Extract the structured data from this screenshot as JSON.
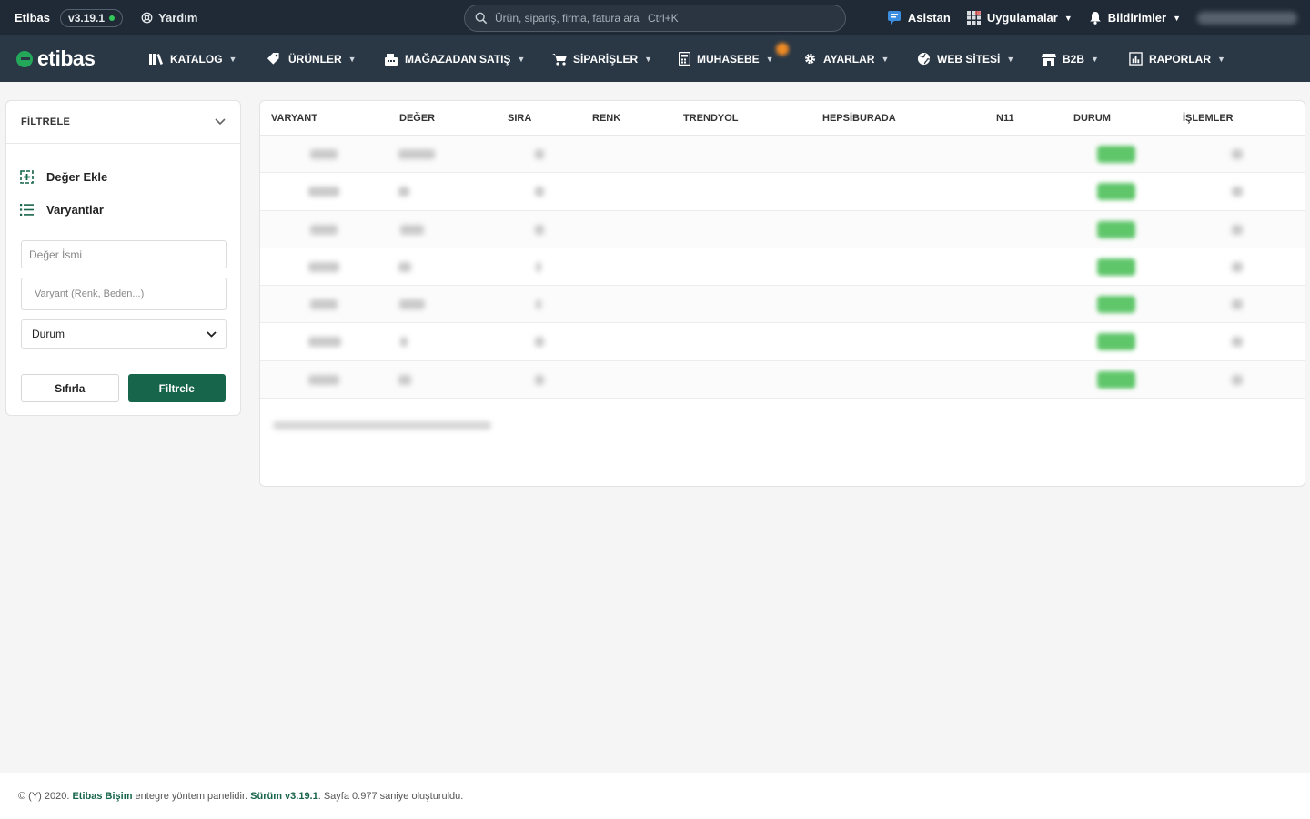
{
  "topbar": {
    "brand": "Etibas",
    "version": "v3.19.1",
    "help_label": "Yardım",
    "search_placeholder": "Ürün, sipariş, firma, fatura ara...",
    "search_shortcut": "Ctrl+K",
    "assistant_label": "Asistan",
    "apps_label": "Uygulamalar",
    "notifications_label": "Bildirimler"
  },
  "navbar": {
    "logo_text": "etibas",
    "items": [
      {
        "label": "KATALOG",
        "icon": "books-icon"
      },
      {
        "label": "ÜRÜNLER",
        "icon": "tag-icon"
      },
      {
        "label": "MAĞAZADAN SATIŞ",
        "icon": "cash-register-icon"
      },
      {
        "label": "SİPARİŞLER",
        "icon": "cart-icon"
      },
      {
        "label": "MUHASEBE",
        "icon": "calculator-icon"
      },
      {
        "label": "AYARLAR",
        "icon": "gear-icon"
      },
      {
        "label": "WEB SİTESİ",
        "icon": "globe-icon"
      },
      {
        "label": "B2B",
        "icon": "store-icon"
      },
      {
        "label": "RAPORLAR",
        "icon": "report-icon"
      }
    ]
  },
  "filter": {
    "title": "FİLTRELE",
    "links": [
      {
        "label": "Değer Ekle",
        "icon": "add-square-icon"
      },
      {
        "label": "Varyantlar",
        "icon": "list-icon"
      }
    ],
    "value_name_placeholder": "Değer İsmi",
    "variant_placeholder": "Varyant (Renk, Beden...)",
    "status_select": "Durum",
    "reset_label": "Sıfırla",
    "filter_label": "Filtrele"
  },
  "table": {
    "columns": [
      "VARYANT",
      "DEĞER",
      "SIRA",
      "RENK",
      "TRENDYOL",
      "HEPSİBURADA",
      "N11",
      "DURUM",
      "İŞLEMLER"
    ]
  },
  "footer": {
    "prefix": "© (Y) 2020. ",
    "company": "Etibas Bişim",
    "middle": " entegre yöntem panelidir. ",
    "version_label": "Sürüm v3.19.1",
    "suffix": ". Sayfa 0.977 saniye oluşturuldu."
  },
  "colors": {
    "topbar_bg": "#1f2a36",
    "navbar_bg": "#2a3846",
    "accent_green": "#17654a",
    "status_green": "#5fc66a"
  }
}
